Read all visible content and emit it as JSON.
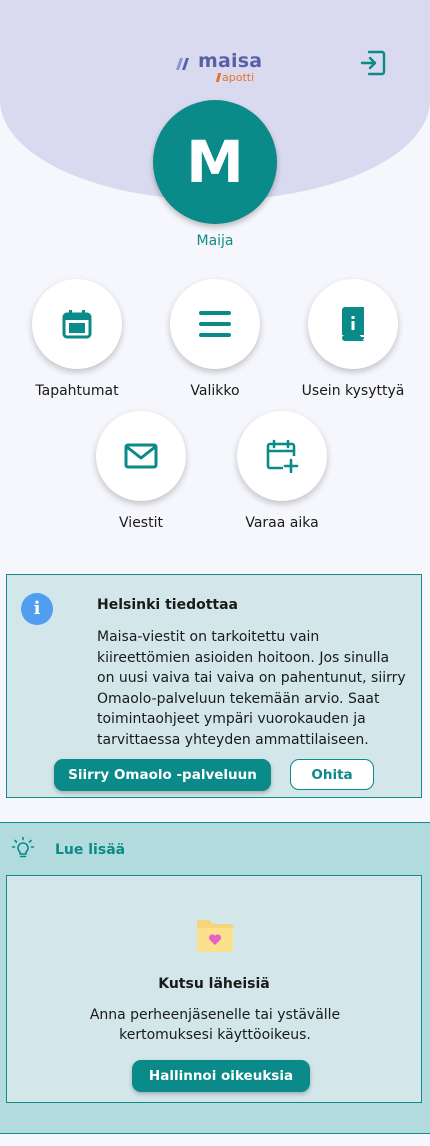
{
  "header": {
    "logo_name": "maisa",
    "logo_sub": "apotti",
    "logout_icon": "logout-icon"
  },
  "user": {
    "initial": "M",
    "name": "Maija"
  },
  "nav": [
    {
      "label": "Tapahtumat",
      "icon": "calendar-icon"
    },
    {
      "label": "Valikko",
      "icon": "menu-icon"
    },
    {
      "label": "Usein kysyttyä",
      "icon": "faq-book-icon"
    },
    {
      "label": "Viestit",
      "icon": "envelope-icon"
    },
    {
      "label": "Varaa aika",
      "icon": "calendar-add-icon"
    }
  ],
  "notice": {
    "icon": "info-icon",
    "icon_text": "i",
    "title": "Helsinki tiedottaa",
    "body": "Maisa-viestit on tarkoitettu vain kiireettömien asioiden hoitoon. Jos sinulla on uusi vaiva tai vaiva on pahentunut, siirry Omaolo-palveluun tekemään arvio. Saat toimintaohjeet ympäri vuorokauden ja tarvittaessa yhteyden ammattilaiseen.",
    "primary_button": "Siirry Omaolo -palveluun",
    "secondary_button": "Ohita"
  },
  "read_more": {
    "icon": "lightbulb-icon",
    "title": "Lue lisää",
    "card": {
      "icon": "folder-heart-icon",
      "title": "Kutsu läheisiä",
      "text": "Anna perheenjäsenelle tai ystävälle kertomuksesi käyttöoikeus.",
      "button": "Hallinnoi oikeuksia"
    }
  },
  "colors": {
    "accent": "#0a8a88",
    "header_bg": "#d9d9ef",
    "notice_bg": "#d3e7eb",
    "read_more_bg": "#b2dbdd",
    "info_blue": "#4f9ef0"
  }
}
